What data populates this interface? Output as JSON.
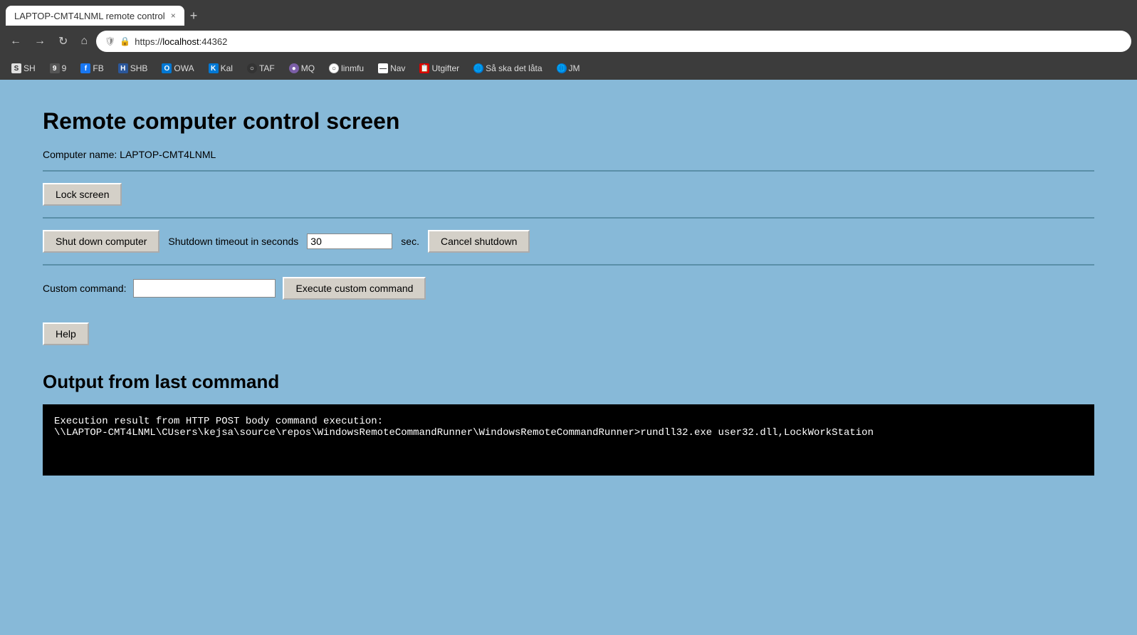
{
  "browser": {
    "tab_title": "LAPTOP-CMT4LNML remote control",
    "tab_close": "×",
    "new_tab": "+",
    "nav_back": "←",
    "nav_forward": "→",
    "nav_refresh": "↻",
    "nav_home": "⌂",
    "address_prefix": "https://",
    "address_host": "localhost",
    "address_port": ":44362",
    "bookmarks": [
      {
        "id": "SH",
        "label": "SH",
        "icon_class": "bm-sh"
      },
      {
        "id": "9",
        "label": "9",
        "icon_class": "bm-9"
      },
      {
        "id": "FB",
        "label": "FB",
        "icon_class": "bm-fb"
      },
      {
        "id": "SHB",
        "label": "SHB",
        "icon_class": "bm-shb"
      },
      {
        "id": "OWA",
        "label": "OWA",
        "icon_class": "bm-owa"
      },
      {
        "id": "Kal",
        "label": "Kal",
        "icon_class": "bm-kal"
      },
      {
        "id": "TAF",
        "label": "TAF",
        "icon_class": "bm-taf"
      },
      {
        "id": "MQ",
        "label": "MQ",
        "icon_class": "bm-mq"
      },
      {
        "id": "linmfu",
        "label": "linmfu",
        "icon_class": "bm-linmfu"
      },
      {
        "id": "Nav",
        "label": "Nav",
        "icon_class": "bm-nav"
      },
      {
        "id": "Utgifter",
        "label": "Utgifter",
        "icon_class": "bm-utg"
      },
      {
        "id": "Saska",
        "label": "Så ska det låta",
        "icon_class": "bm-saska"
      },
      {
        "id": "JM",
        "label": "JM",
        "icon_class": "bm-jm"
      }
    ]
  },
  "page": {
    "title": "Remote computer control screen",
    "computer_name_label": "Computer name:",
    "computer_name_value": "LAPTOP-CMT4LNML",
    "lock_screen_btn": "Lock screen",
    "shutdown_btn": "Shut down computer",
    "shutdown_timeout_label": "Shutdown timeout in seconds",
    "shutdown_timeout_value": "30",
    "shutdown_sec_label": "sec.",
    "cancel_shutdown_btn": "Cancel shutdown",
    "custom_command_label": "Custom command:",
    "custom_command_placeholder": "",
    "execute_btn": "Execute custom command",
    "help_btn": "Help",
    "output_heading": "Output from last command",
    "output_text": "Execution result from HTTP POST body command execution:\n\\\\LAPTOP-CMT4LNML\\CUsers\\kejsa\\source\\repos\\WindowsRemoteCommandRunner\\WindowsRemoteCommandRunner>rundll32.exe user32.dll,LockWorkStation"
  }
}
